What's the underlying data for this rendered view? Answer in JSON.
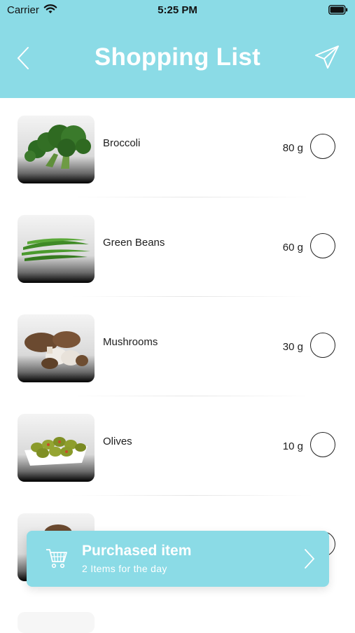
{
  "status_bar": {
    "carrier": "Carrier",
    "time": "5:25 PM"
  },
  "header": {
    "title": "Shopping List"
  },
  "items": [
    {
      "name": "Broccoli",
      "quantity": "80 g",
      "image": "broccoli-image"
    },
    {
      "name": "Green Beans",
      "quantity": "60 g",
      "image": "green-beans-image"
    },
    {
      "name": "Mushrooms",
      "quantity": "30 g",
      "image": "mushrooms-image"
    },
    {
      "name": "Olives",
      "quantity": "10 g",
      "image": "olives-image"
    },
    {
      "name": "",
      "quantity": "",
      "image": "partially-hidden-item-image"
    }
  ],
  "purchased": {
    "title": "Purchased item",
    "subtitle": "2 Items for the day"
  },
  "colors": {
    "accent": "#8bdbe6",
    "text": "#1d1d1d"
  }
}
